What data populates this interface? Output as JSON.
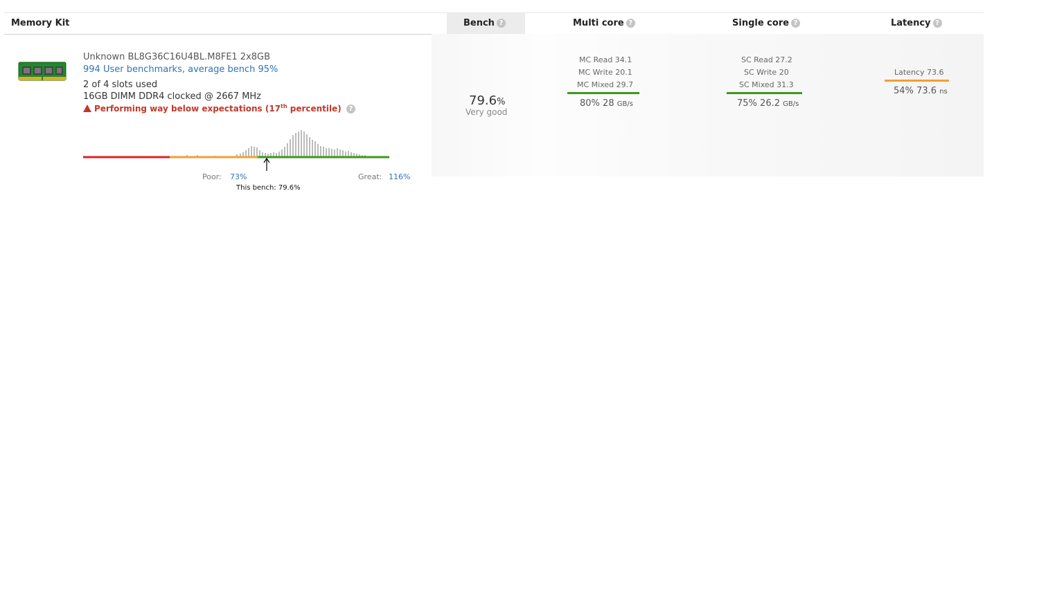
{
  "header": {
    "memory_kit": "Memory Kit",
    "bench": "Bench",
    "multi_core": "Multi core",
    "single_core": "Single core",
    "latency": "Latency",
    "help_glyph": "?"
  },
  "item": {
    "name": "Unknown BL8G36C16U4BL.M8FE1 2x8GB",
    "user_benchmarks": "994 User benchmarks, average bench 95%",
    "slots": "2 of 4 slots used",
    "dimm": "16GB DIMM DDR4 clocked @ 2667 MHz",
    "warning_prefix": "Performing way below expectations (17",
    "warning_sup": "th",
    "warning_suffix": " percentile)",
    "poor_label": "Poor:",
    "poor_value": "73%",
    "great_label": "Great:",
    "great_value": "116%",
    "this_bench": "This bench: 79.6%"
  },
  "bench": {
    "value": "79.6",
    "unit": "%",
    "desc": "Very good"
  },
  "multi_core": {
    "read": "MC Read 34.1",
    "write": "MC Write 20.1",
    "mixed": "MC Mixed 29.7",
    "summary_pct": "80%",
    "summary_val": "28",
    "summary_unit": "GB/s",
    "bar_color": "#3a9a1a"
  },
  "single_core": {
    "read": "SC Read 27.2",
    "write": "SC Write 20",
    "mixed": "SC Mixed 31.3",
    "summary_pct": "75%",
    "summary_val": "26.2",
    "summary_unit": "GB/s",
    "bar_color": "#3a9a1a"
  },
  "latency": {
    "label": "Latency 73.6",
    "summary_pct": "54%",
    "summary_val": "73.6",
    "summary_unit": "ns",
    "bar_color": "#f0a030"
  },
  "colors": {
    "red": "#dd2222",
    "orange": "#f0a030",
    "green": "#3a9a1a",
    "link": "#2f73b6",
    "warning": "#c0392b"
  },
  "icons": [
    "ram-module-icon",
    "help-icon",
    "warning-icon",
    "arrow-up-icon"
  ]
}
